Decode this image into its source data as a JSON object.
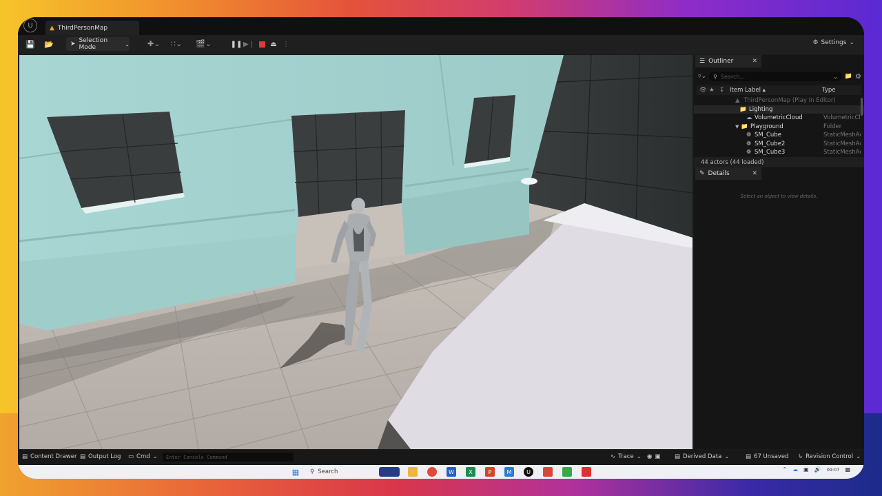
{
  "window": {
    "tab_title": "ThirdPersonMap"
  },
  "toolbar": {
    "selection_mode": "Selection Mode",
    "settings_label": "Settings"
  },
  "outliner": {
    "tab_label": "Outliner",
    "search_placeholder": "Search...",
    "col_item_label": "Item Label ▴",
    "col_type": "Type",
    "rows": [
      {
        "label": "ThirdPersonMap (Play In Editor)",
        "type": ""
      },
      {
        "label": "Lighting",
        "type": ""
      },
      {
        "label": "VolumetricCloud",
        "type": "VolumetricCl"
      },
      {
        "label": "Playground",
        "type": "Folder"
      },
      {
        "label": "SM_Cube",
        "type": "StaticMeshAc"
      },
      {
        "label": "SM_Cube2",
        "type": "StaticMeshAc"
      },
      {
        "label": "SM_Cube3",
        "type": "StaticMeshAc"
      }
    ],
    "footer": "44 actors (44 loaded)"
  },
  "details": {
    "tab_label": "Details",
    "hint": "Select an object to view details."
  },
  "statusbar": {
    "content_drawer": "Content Drawer",
    "output_log": "Output Log",
    "cmd": "Cmd",
    "console_placeholder": "Enter Console Command",
    "trace": "Trace",
    "derived_data": "Derived Data",
    "unsaved": "67 Unsaved",
    "revision_control": "Revision Control"
  },
  "taskbar": {
    "search": "Search",
    "time": "09:07"
  },
  "colors": {
    "stop_red": "#e03a3a",
    "folder_yellow": "#c9a24a",
    "accent_orange": "#e8a93a"
  }
}
